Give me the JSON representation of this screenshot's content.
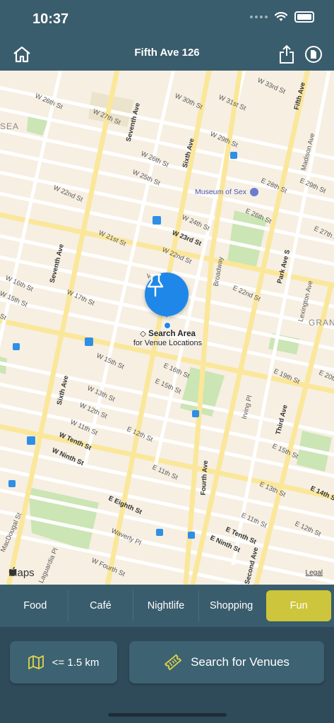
{
  "status": {
    "time": "10:37"
  },
  "nav": {
    "title": "Fifth Ave 126",
    "icons": {
      "home": "house-icon",
      "share": "share-icon",
      "doc": "document-icon"
    }
  },
  "map": {
    "streets": {
      "w33": "W 33rd St",
      "w31": "W 31st St",
      "w30": "W 30th St",
      "w29": "W 29th St",
      "w28": "W 28th St",
      "w27": "W 27th St",
      "w26a": "W 26th St",
      "w26b": "W 26th St",
      "w25": "W 25th St",
      "e28": "E 28th St",
      "e29": "E 29th St",
      "e26": "E 26th St",
      "e27": "E 27th St",
      "w24": "W 24th St",
      "w23": "W 23rd St",
      "w22a": "W 22nd St",
      "w22b": "W 22nd St",
      "w21": "W 21st St",
      "e22": "E 22nd St",
      "w17": "W 17th St",
      "w16": "W 16th St",
      "w15a": "W 15th St",
      "w15b": "W 15th St",
      "e16": "E 16th St",
      "e15a": "E 15th St",
      "e19": "E 19th St",
      "e20": "E 20th St",
      "w13": "W 13th St",
      "w12": "W 12th St",
      "w11": "W 11th St",
      "e12": "E 12th St",
      "e11": "E 11th St",
      "e15b": "E 15th St",
      "e14": "E 14th St",
      "e13": "E 13th St",
      "e12b": "E 12th St",
      "e11b": "E 11th St",
      "wtenth": "W Tenth St",
      "wninth": "W Ninth St",
      "eeighth": "E Eighth St",
      "etenth": "E Tenth St",
      "eninth": "E Ninth St",
      "waverly": "Waverly Pl",
      "wfourth": "W Fourth St",
      "macdougal": "MacDougal St",
      "irving": "Irving Pl",
      "broadway": "Broadway",
      "seventh1": "Seventh Ave",
      "seventh2": "Seventh Ave",
      "sixth1": "Sixth Ave",
      "sixth2": "Sixth Ave",
      "fifth": "Fifth Ave",
      "madison": "Madison Ave",
      "parkave": "Park Ave S",
      "lexington": "Lexington Ave",
      "third": "Third Ave",
      "second": "Second Ave",
      "fourth": "Fourth Ave",
      "wst": "W",
      "st": "St",
      "sea": "SEA",
      "gran": "GRAN",
      "lagu": "Laguardia Pl"
    },
    "poi": "Museum of Sex",
    "pin_line1": "Search Area",
    "pin_line2": "for Venue Locations",
    "maps_logo": "Maps",
    "legal": "Legal"
  },
  "categories": [
    {
      "label": "Food",
      "active": false
    },
    {
      "label": "Café",
      "active": false
    },
    {
      "label": "Nightlife",
      "active": false
    },
    {
      "label": "Shopping",
      "active": false
    },
    {
      "label": "Fun",
      "active": true
    }
  ],
  "controls": {
    "distance": "<= 1.5 km",
    "search": "Search for Venues"
  },
  "colors": {
    "accent": "#cdc53b",
    "bar": "#3a5d6d",
    "pin": "#1f87e8"
  }
}
